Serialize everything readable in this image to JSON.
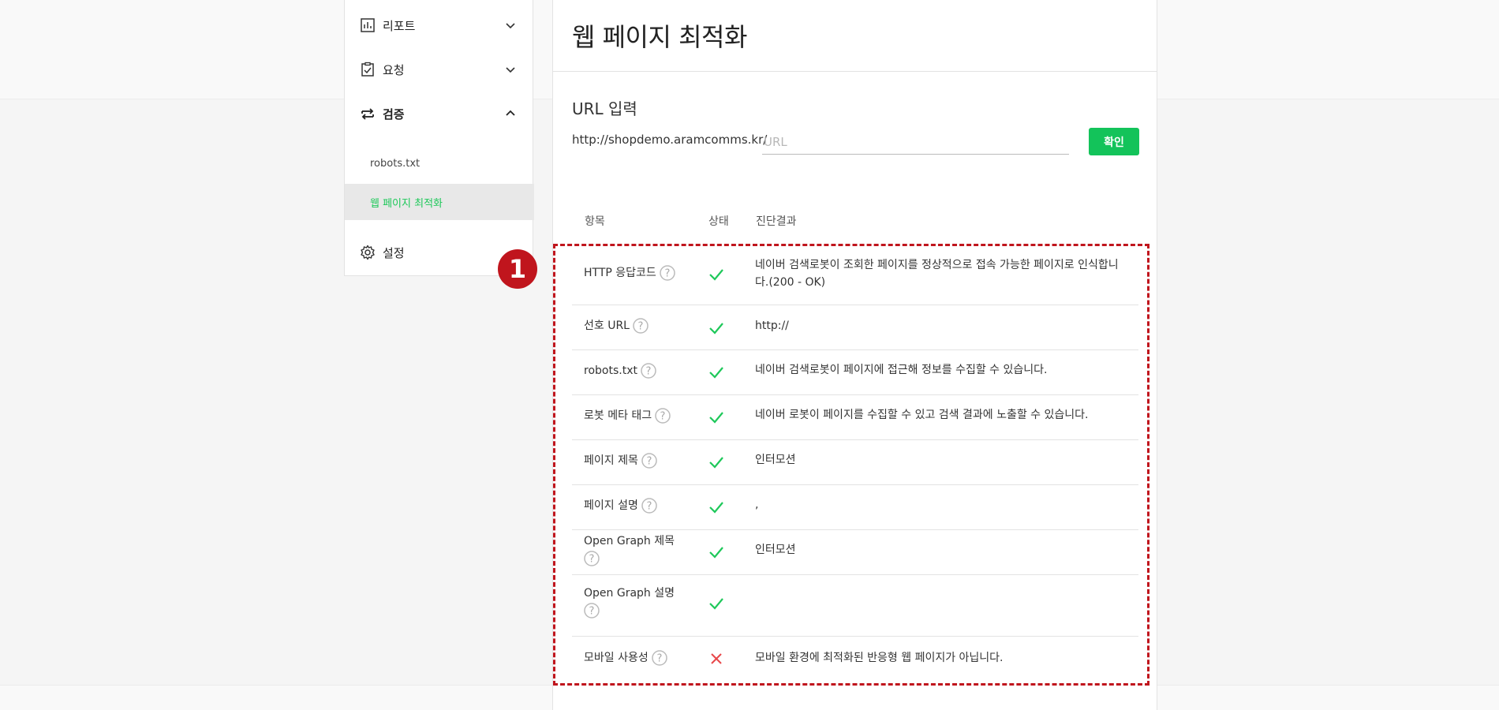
{
  "sidebar": {
    "items": [
      {
        "label": "리포트",
        "icon": "bar-chart-icon",
        "expanded": false
      },
      {
        "label": "요청",
        "icon": "clipboard-check-icon",
        "expanded": false
      },
      {
        "label": "검증",
        "icon": "swap-arrows-icon",
        "expanded": true
      },
      {
        "label": "설정",
        "icon": "gear-icon"
      }
    ],
    "sub_items": [
      {
        "label": "robots.txt",
        "active": false
      },
      {
        "label": "웹 페이지 최적화",
        "active": true
      }
    ]
  },
  "annotation": {
    "badge": "1",
    "color": "#c0151d"
  },
  "main": {
    "title": "웹 페이지 최적화",
    "url_section": {
      "label": "URL 입력",
      "prefix": "http://shopdemo.aramcomms.kr/",
      "placeholder": "URL",
      "button": "확인"
    },
    "table": {
      "headers": [
        "항목",
        "상태",
        "진단결과"
      ],
      "rows": [
        {
          "item": "HTTP 응답코드",
          "status": "ok",
          "result": "네이버 검색로봇이 조회한 페이지를 정상적으로 접속 가능한 페이지로 인식합니다.(200 - OK)"
        },
        {
          "item": "선호 URL",
          "status": "ok",
          "result": "http://"
        },
        {
          "item": "robots.txt",
          "status": "ok",
          "result": "네이버 검색로봇이 페이지에 접근해 정보를 수집할 수 있습니다."
        },
        {
          "item": "로봇 메타 태그",
          "status": "ok",
          "result": "네이버 로봇이 페이지를 수집할 수 있고 검색 결과에 노출할 수 있습니다."
        },
        {
          "item": "페이지 제목",
          "status": "ok",
          "result": "인터모션"
        },
        {
          "item": "페이지 설명",
          "status": "ok",
          "result": ","
        },
        {
          "item": "Open Graph 제목",
          "status": "ok",
          "result": "인터모션"
        },
        {
          "item": "Open Graph 설명",
          "status": "ok",
          "result": ""
        },
        {
          "item": "모바일 사용성",
          "status": "fail",
          "result": "모바일 환경에 최적화된 반응형 웹 페이지가 아닙니다."
        }
      ]
    }
  },
  "colors": {
    "accent": "#13c35a",
    "check": "#1ec85a",
    "fail": "#e8474a",
    "annotation": "#c0151d"
  }
}
